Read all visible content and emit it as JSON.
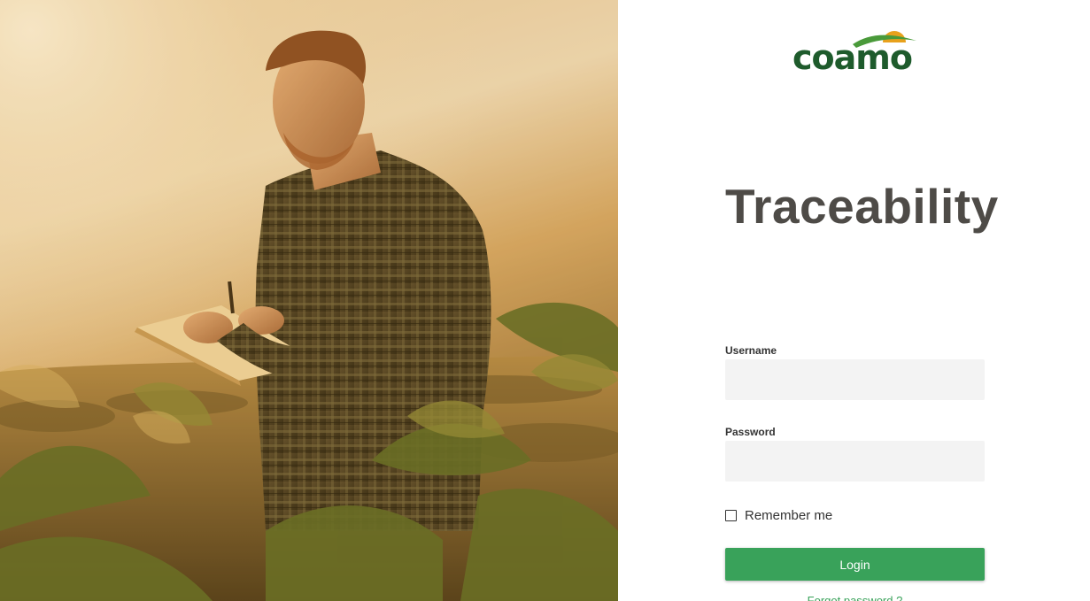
{
  "brand": {
    "logo_text": "coamo",
    "logo_green": "#1e5b2c",
    "logo_sun": "#e8a11c"
  },
  "hero": {
    "image": "farmer-in-soybean-field-photo"
  },
  "login": {
    "title": "Traceability",
    "username_label": "Username",
    "username_value": "",
    "password_label": "Password",
    "password_value": "",
    "remember_label": "Remember me",
    "remember_checked": false,
    "login_button": "Login",
    "forgot_link": "Forgot password ?"
  },
  "colors": {
    "accent": "#39a25a",
    "title": "#4e4b47",
    "input_bg": "#f3f3f3"
  }
}
